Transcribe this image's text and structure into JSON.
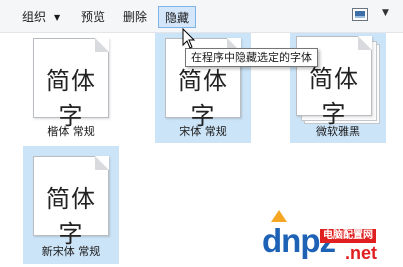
{
  "toolbar": {
    "organize_label": "组织",
    "organize_arrow": "▼",
    "preview_label": "预览",
    "delete_label": "删除",
    "hide_label": "隐藏",
    "view_dropdown_arrow": "▼"
  },
  "tooltip": {
    "text": "在程序中隐藏选定的字体"
  },
  "fonts": [
    {
      "preview": "简体字",
      "name": "楷体 常规",
      "selected": false
    },
    {
      "preview": "简体字",
      "name": "宋体 常规",
      "selected": true
    },
    {
      "preview": "简体字",
      "name": "微软雅黑",
      "selected": true
    },
    {
      "preview": "简体字",
      "name": "新宋体 常规",
      "selected": true
    }
  ],
  "watermark": {
    "brand": "dnpz",
    "tag": "电脑配置网",
    "domain": ".net"
  },
  "colors": {
    "selection": "#cce4f7",
    "active_button": "#d4e6fa",
    "watermark_blue": "#1e62b5",
    "watermark_red": "#e02020"
  }
}
